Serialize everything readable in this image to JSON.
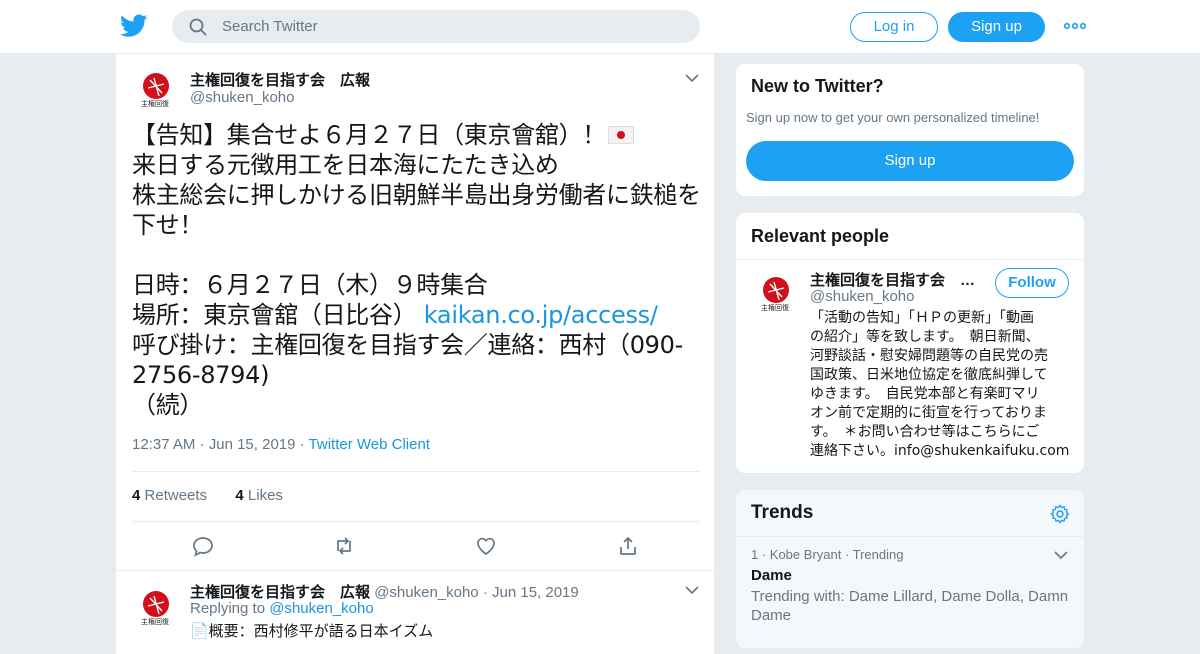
{
  "header": {
    "search_placeholder": "Search Twitter",
    "login_label": "Log in",
    "signup_label": "Sign up"
  },
  "tweet": {
    "author_name": "主権回復を目指す会　広報",
    "author_handle": "@shuken_koho",
    "lines": [
      "【告知】集合せよ６月２７日（東京會舘）！",
      "来日する元徴用工を日本海にたたき込め",
      "株主総会に押しかける旧朝鮮半島出身労働者に鉄槌を",
      "下せ！",
      "",
      "日時：６月２７日（木）９時集合",
      "場所：東京會舘（日比谷）",
      "呼び掛け：主権回復を目指す会／連絡：西村（090-",
      "2756-8794)",
      "（続）"
    ],
    "link_text": "kaikan.co.jp/access/",
    "time": "12:37 AM",
    "date": "Jun 15, 2019",
    "client": "Twitter Web Client",
    "retweets_count": "4",
    "retweets_label": "Retweets",
    "likes_count": "4",
    "likes_label": "Likes"
  },
  "reply_tweet": {
    "author_name": "主権回復を目指す会　広報",
    "author_handle": "@shuken_koho",
    "date": "Jun 15, 2019",
    "replying_prefix": "Replying to",
    "replying_handle": "@shuken_koho",
    "text_preview": "📄概要：西村修平が語る日本イズム"
  },
  "sidebar": {
    "new_to_twitter": {
      "title": "New to Twitter?",
      "subtitle": "Sign up now to get your own personalized timeline!",
      "button": "Sign up"
    },
    "relevant_people": {
      "title": "Relevant people",
      "name": "主権回復を目指す会　…",
      "handle": "@shuken_koho",
      "follow_label": "Follow",
      "bio_lines": [
        "「活動の告知」「ＨＰの更新」「動画",
        "の紹介」等を致します。　朝日新聞、",
        "河野談話・慰安婦問題等の自民党の売",
        "国政策、日米地位協定を徹底糾弾して",
        "ゆきます。　自民党本部と有楽町マリ",
        "オン前で定期的に街宣を行っておりま",
        "す。　＊お問い合わせ等はこちらにご",
        "連絡下さい。info@shukenkaifuku.com"
      ]
    },
    "trends": {
      "title": "Trends",
      "items": [
        {
          "meta": "1 · Kobe Bryant · Trending",
          "name": "Dame",
          "desc_line1": "Trending with: Dame Lillard, Dame Dolla, Damn",
          "desc_line2": "Dame"
        }
      ]
    }
  },
  "colors": {
    "accent": "#1da1f2",
    "link": "#1b95e0",
    "background": "#e6ecf0"
  }
}
